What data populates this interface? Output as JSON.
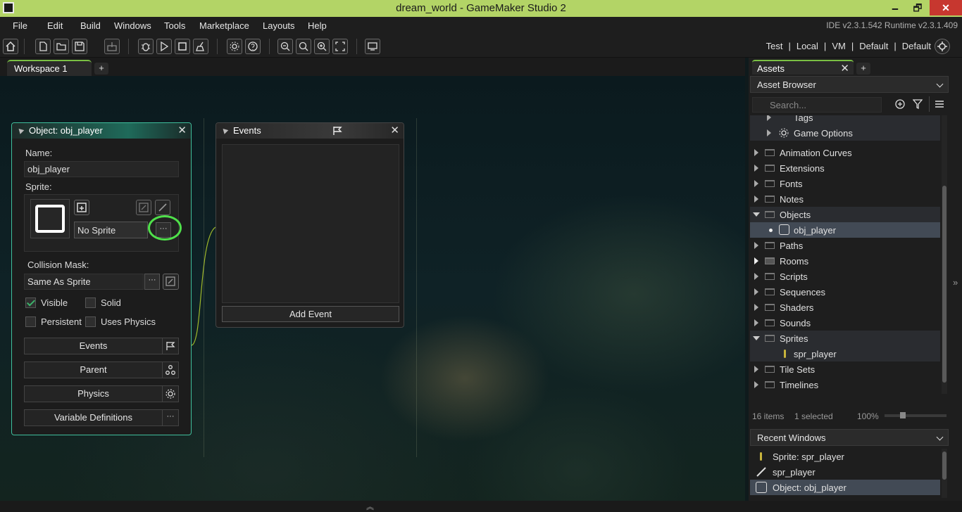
{
  "window": {
    "title": "dream_world - GameMaker Studio 2",
    "minimize": "🗕",
    "restore": "🗗",
    "close": "✕"
  },
  "menu": {
    "items": [
      "File",
      "Edit",
      "Build",
      "Windows",
      "Tools",
      "Marketplace",
      "Layouts",
      "Help"
    ],
    "version": "IDE v2.3.1.542  Runtime v2.3.1.409"
  },
  "target": {
    "items": [
      "Test",
      "|",
      "Local",
      "|",
      "VM",
      "|",
      "Default",
      "|",
      "Default"
    ]
  },
  "workspace": {
    "tab": "Workspace 1",
    "add": "+"
  },
  "object_editor": {
    "title": "Object: obj_player",
    "close": "✕",
    "name_label": "Name:",
    "name_value": "obj_player",
    "sprite_label": "Sprite:",
    "sprite_value": "No Sprite",
    "dots": "···",
    "collision_label": "Collision Mask:",
    "collision_value": "Same As Sprite",
    "visible": "Visible",
    "solid": "Solid",
    "persistent": "Persistent",
    "uses_physics": "Uses Physics",
    "visible_checked": true,
    "events_btn": "Events",
    "parent_btn": "Parent",
    "physics_btn": "Physics",
    "variables_btn": "Variable Definitions"
  },
  "events_panel": {
    "title": "Events",
    "close": "✕",
    "add_event": "Add Event"
  },
  "assets": {
    "tab": "Assets",
    "close": "✕",
    "add": "+",
    "browser": "Asset Browser",
    "search_placeholder": "Search...",
    "tree": [
      {
        "label": "Tags",
        "indent": 2
      },
      {
        "label": "Game Options",
        "indent": 2
      },
      {
        "label": "Animation Curves"
      },
      {
        "label": "Extensions"
      },
      {
        "label": "Fonts"
      },
      {
        "label": "Notes"
      },
      {
        "label": "Objects",
        "open": true
      },
      {
        "label": "obj_player",
        "child": true
      },
      {
        "label": "Paths"
      },
      {
        "label": "Rooms"
      },
      {
        "label": "Scripts"
      },
      {
        "label": "Sequences"
      },
      {
        "label": "Shaders"
      },
      {
        "label": "Sounds"
      },
      {
        "label": "Sprites",
        "open": true
      },
      {
        "label": "spr_player",
        "child": true
      },
      {
        "label": "Tile Sets"
      },
      {
        "label": "Timelines"
      }
    ],
    "status_items": "16 items",
    "status_selected": "1 selected",
    "zoom": "100%",
    "recent_title": "Recent Windows",
    "recent": [
      "Sprite: spr_player",
      "spr_player",
      "Object: obj_player"
    ]
  },
  "bottom": {
    "chevron": "︽"
  }
}
